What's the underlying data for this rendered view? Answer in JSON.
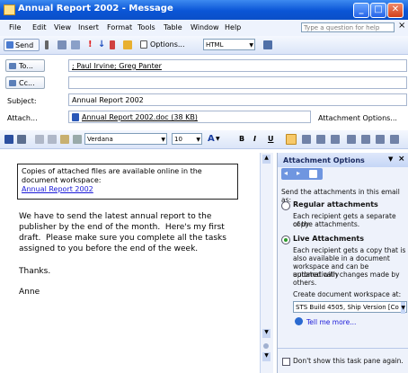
{
  "window": {
    "title": "Annual Report 2002 - Message",
    "btn_min": "_",
    "btn_max": "□",
    "btn_close": "✕"
  },
  "menu": {
    "items": [
      "File",
      "Edit",
      "View",
      "Insert",
      "Format",
      "Tools",
      "Table",
      "Window",
      "Help"
    ],
    "ask_placeholder": "Type a question for help",
    "close_glyph": "×"
  },
  "toolbar1": {
    "send": "Send",
    "options": "Options...",
    "format": "HTML"
  },
  "header": {
    "to_label": "To...",
    "to_value": "; Paul Irvine; Greg Panter",
    "cc_label": "Cc...",
    "cc_value": "",
    "subject_label": "Subject:",
    "subject_value": "Annual Report 2002",
    "attach_label": "Attach...",
    "attach_value": "Annual Report 2002.doc (38 KB)",
    "attach_options": "Attachment Options..."
  },
  "toolbar2": {
    "font": "Verdana",
    "size": "10",
    "bold": "B",
    "italic": "I",
    "underline": "U"
  },
  "message": {
    "box_line1": "Copies of attached files are available online in the",
    "box_line2": "document workspace:",
    "box_link": "Annual Report 2002",
    "p1": "We have to send the latest annual report to the",
    "p2": "publisher by the end of the month.  Here's my first",
    "p3": "draft.  Please make sure you complete all the tasks",
    "p4": "assigned to you before the end of the week.",
    "thanks": "Thanks.",
    "sign": "Anne"
  },
  "taskpane": {
    "title": "Attachment Options",
    "intro": "Send the attachments in this email as:",
    "opt1_label": "Regular attachments",
    "opt1_d1": "Each recipient gets a separate copy",
    "opt1_d2": "of the attachments.",
    "opt2_label": "Live Attachments",
    "opt2_d1": "Each recipient gets a copy that is",
    "opt2_d2": "also available in a document",
    "opt2_d3": "workspace and can be automatically",
    "opt2_d4": "updated with changes made by",
    "opt2_d5": "others.",
    "create_label": "Create document workspace at:",
    "server": "STS Build 4505, Ship Version [Co",
    "tell_more": "Tell me more...",
    "dont_show": "Don't show this task pane again."
  }
}
